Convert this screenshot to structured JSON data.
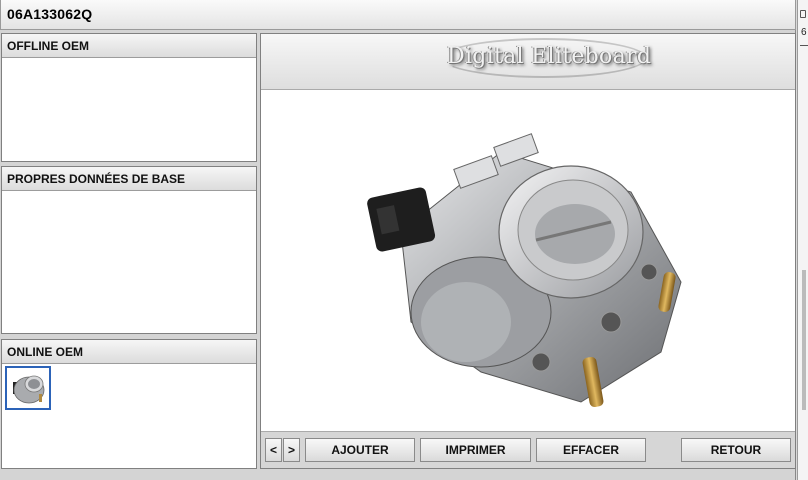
{
  "window": {
    "title": "06A133062Q"
  },
  "panels": {
    "offline_oem": {
      "title": "OFFLINE OEM"
    },
    "base_data": {
      "title": "PROPRES DONNÉES DE BASE"
    },
    "online_oem": {
      "title": "ONLINE OEM"
    }
  },
  "banner": {
    "text": "Digital Eliteboard"
  },
  "toolbar": {
    "prev": "<",
    "next": ">",
    "add": "AJOUTER",
    "print": "IMPRIMER",
    "clear": "EFFACER",
    "back": "RETOUR"
  },
  "edge": {
    "mark": "6"
  },
  "icons": [
    "throttle-body-image",
    "thumbnail-image"
  ],
  "colors": {
    "thumb_border": "#2c63b8",
    "panel_header": "#dcdcdc"
  }
}
